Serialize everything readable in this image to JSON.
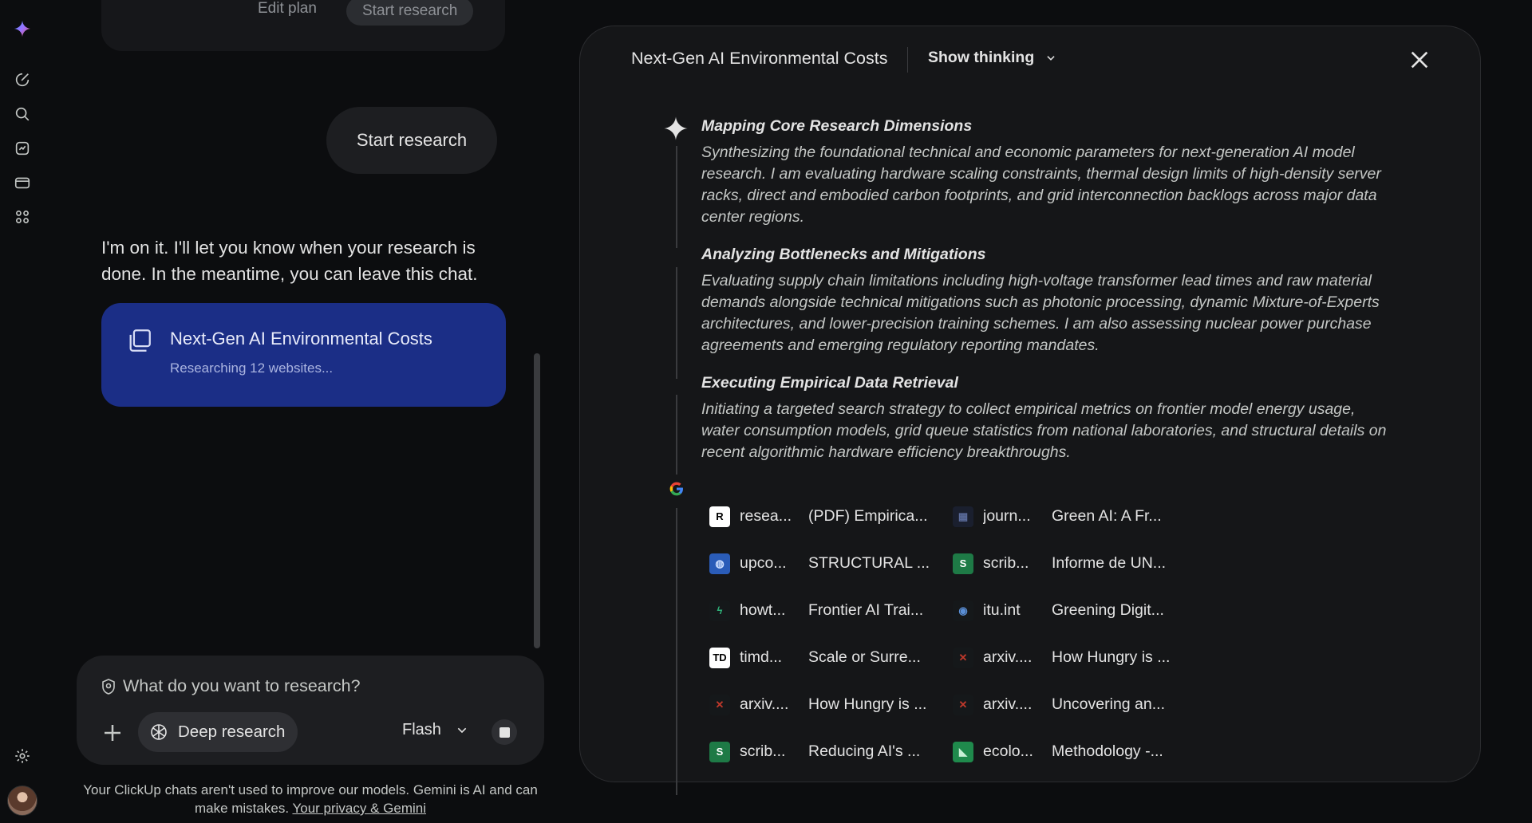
{
  "rail": {
    "icons": [
      "gemini-logo-icon",
      "new-chat-icon",
      "search-icon",
      "gems-icon",
      "library-icon",
      "apps-grid-icon",
      "settings-icon"
    ]
  },
  "chat": {
    "edit_plan": "Edit plan",
    "start_research_top": "Start research",
    "user_message": "Start research",
    "reply": "I'm on it. I'll let you know when your research is done. In the meantime, you can leave this chat.",
    "research_card": {
      "title": "Next-Gen AI Environmental Costs",
      "status": "Researching 12 websites..."
    }
  },
  "composer": {
    "placeholder": "What do you want to research?",
    "tool_label": "Deep research",
    "model": "Flash"
  },
  "disclaimer": {
    "text": "Your ClickUp chats aren't used to improve our models. Gemini is AI and can make mistakes.",
    "link": "Your privacy & Gemini"
  },
  "panel": {
    "title": "Next-Gen AI Environmental Costs",
    "show_thinking": "Show thinking",
    "steps": [
      {
        "title": "Mapping Core Research Dimensions",
        "body": "Synthesizing the foundational technical and economic parameters for next-generation AI model research. I am evaluating hardware scaling constraints, thermal design limits of high-density server racks, direct and embodied carbon footprints, and grid interconnection backlogs across major data center regions."
      },
      {
        "title": "Analyzing Bottlenecks and Mitigations",
        "body": "Evaluating supply chain limitations including high-voltage transformer lead times and raw material demands alongside technical mitigations such as photonic processing, dynamic Mixture-of-Experts architectures, and lower-precision training schemes. I am also assessing nuclear power purchase agreements and emerging regulatory reporting mandates."
      },
      {
        "title": "Executing Empirical Data Retrieval",
        "body": "Initiating a targeted search strategy to collect empirical metrics on frontier model energy usage, water consumption models, grid queue statistics from national laboratories, and structural details on recent algorithmic hardware efficiency breakthroughs."
      }
    ],
    "google_mark": "G",
    "sources": [
      {
        "site": "resea...",
        "title": "(PDF) Empirica...",
        "fav": "R",
        "fav_bg": "#ffffff",
        "fav_fg": "#000000"
      },
      {
        "site": "journ...",
        "title": "Green AI: A Fr...",
        "fav": "▦",
        "fav_bg": "#1a1f2e",
        "fav_fg": "#5a6b9a"
      },
      {
        "site": "upco...",
        "title": "STRUCTURAL ...",
        "fav": "◍",
        "fav_bg": "#2a5cb8",
        "fav_fg": "#cfe0ff"
      },
      {
        "site": "scrib...",
        "title": "Informe de UN...",
        "fav": "S",
        "fav_bg": "#1e7a46",
        "fav_fg": "#ffffff"
      },
      {
        "site": "howt...",
        "title": "Frontier AI Trai...",
        "fav": "ϟ",
        "fav_bg": "#15181a",
        "fav_fg": "#2fb37a"
      },
      {
        "site": "itu.int",
        "title": "Greening Digit...",
        "fav": "◉",
        "fav_bg": "#15181a",
        "fav_fg": "#5a8fd6"
      },
      {
        "site": "timd...",
        "title": "Scale or Surre...",
        "fav": "TD",
        "fav_bg": "#ffffff",
        "fav_fg": "#000000"
      },
      {
        "site": "arxiv....",
        "title": "How Hungry is ...",
        "fav": "✕",
        "fav_bg": "#15181a",
        "fav_fg": "#c0392b"
      },
      {
        "site": "arxiv....",
        "title": "How Hungry is ...",
        "fav": "✕",
        "fav_bg": "#15181a",
        "fav_fg": "#c0392b"
      },
      {
        "site": "arxiv....",
        "title": "Uncovering an...",
        "fav": "✕",
        "fav_bg": "#15181a",
        "fav_fg": "#c0392b"
      },
      {
        "site": "scrib...",
        "title": "Reducing AI's ...",
        "fav": "S",
        "fav_bg": "#1e7a46",
        "fav_fg": "#ffffff"
      },
      {
        "site": "ecolo...",
        "title": "Methodology -...",
        "fav": "◣",
        "fav_bg": "#1f8a4c",
        "fav_fg": "#c8f0d6"
      }
    ]
  }
}
